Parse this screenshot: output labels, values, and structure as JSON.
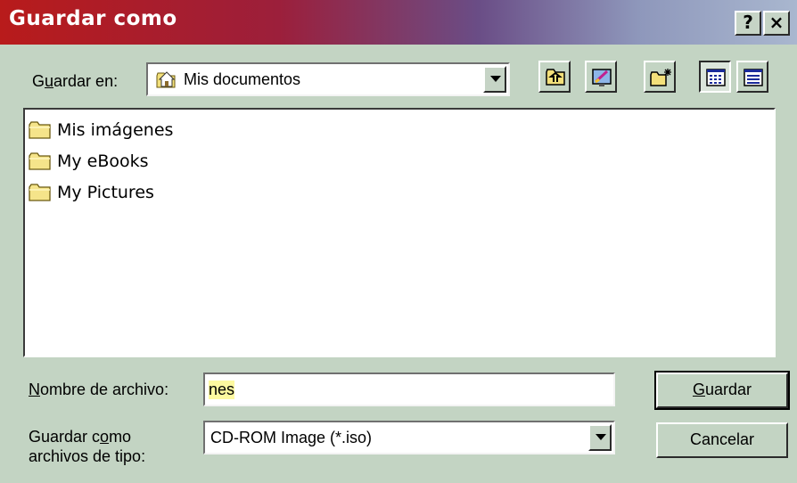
{
  "window": {
    "title": "Guardar como"
  },
  "titlebar_buttons": {
    "help": "?",
    "close": "×"
  },
  "location": {
    "label_prefix": "G",
    "label_underlined": "u",
    "label_suffix": "ardar en:",
    "value": "Mis documentos"
  },
  "toolbar": {
    "buttons": [
      "up-one-level-icon",
      "desktop-icon",
      "new-folder-icon",
      "list-view-icon",
      "details-view-icon"
    ],
    "active": "list-view-icon"
  },
  "files": [
    {
      "name": "Mis imágenes"
    },
    {
      "name": "My eBooks"
    },
    {
      "name": "My Pictures"
    }
  ],
  "filename": {
    "label_underlined": "N",
    "label_suffix": "ombre de archivo:",
    "value": "nes"
  },
  "filetype": {
    "label_line1_prefix": "Guardar c",
    "label_line1_underlined": "o",
    "label_line1_suffix": "mo",
    "label_line2": "archivos de tipo:",
    "value": "CD-ROM Image (*.iso)"
  },
  "buttons": {
    "save_underlined": "G",
    "save_suffix": "uardar",
    "cancel": "Cancelar"
  },
  "colors": {
    "face": "#c3d4c3",
    "title_start": "#b81b1b",
    "title_end": "#a9b7cf",
    "folder": "#f5e48a"
  }
}
